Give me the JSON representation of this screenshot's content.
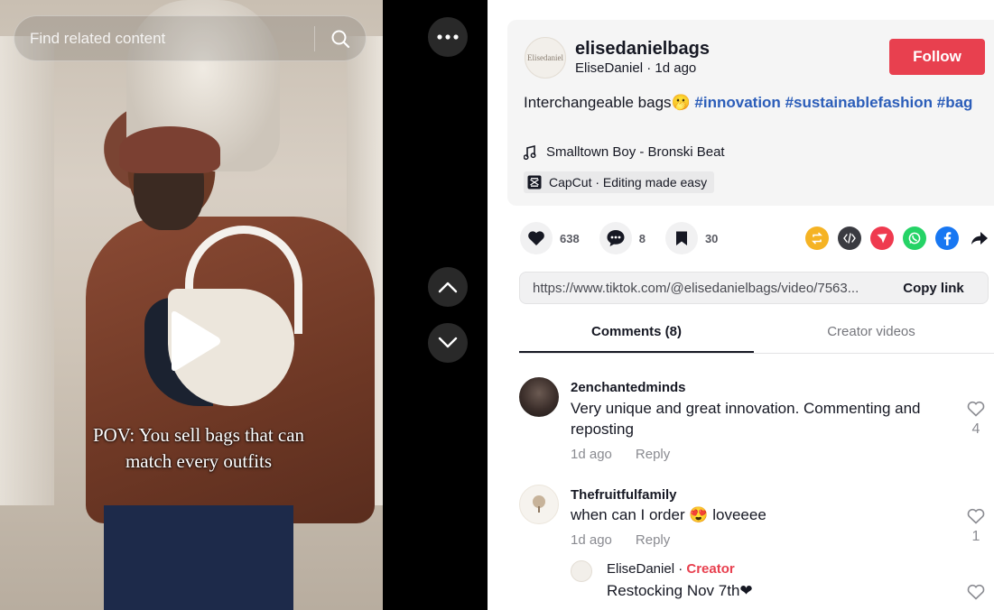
{
  "video": {
    "search_placeholder": "Find related content",
    "caption_line1": "POV: You sell bags that can",
    "caption_line2": "match every outfits"
  },
  "post": {
    "avatar_text": "Elisedaniel",
    "username": "elisedanielbags",
    "display_name": "EliseDaniel",
    "time": "1d ago",
    "follow_label": "Follow",
    "description_text": "Interchangeable bags🫢",
    "hashtags": [
      "#innovation",
      "#sustainablefashion",
      "#bag"
    ],
    "music": "Smalltown Boy - Bronski Beat",
    "capcut": "CapCut · Editing made easy"
  },
  "stats": {
    "likes": "638",
    "comments": "8",
    "saves": "30"
  },
  "share": {
    "url": "https://www.tiktok.com/@elisedanielbags/video/7563...",
    "copy_label": "Copy link"
  },
  "tabs": {
    "comments": "Comments (8)",
    "creator_videos": "Creator videos"
  },
  "comments": [
    {
      "name": "2enchantedminds",
      "text": "Very unique and great innovation. Commenting and reposting",
      "time": "1d ago",
      "reply": "Reply",
      "likes": "4"
    },
    {
      "name": "Thefruitfulfamily",
      "text": "when can I order 😍 loveeee",
      "time": "1d ago",
      "reply": "Reply",
      "likes": "1"
    }
  ],
  "reply": {
    "name": "EliseDaniel",
    "badge": "Creator",
    "text": "Restocking Nov 7th❤"
  },
  "colors": {
    "follow": "#e8404f",
    "hashtag": "#2b5db9"
  }
}
